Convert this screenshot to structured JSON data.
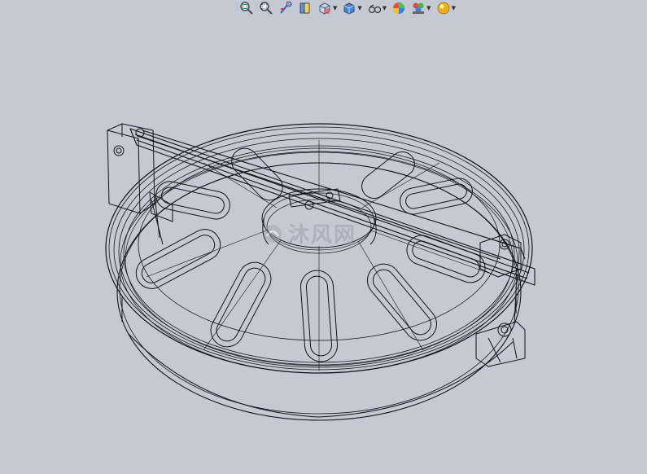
{
  "toolbar": {
    "items": [
      {
        "icon": "zoom-to-fit-icon",
        "has_menu": false
      },
      {
        "icon": "zoom-to-area-icon",
        "has_menu": false
      },
      {
        "icon": "previous-view-icon",
        "has_menu": false
      },
      {
        "icon": "section-view-icon",
        "has_menu": false
      },
      {
        "icon": "view-orientation-icon",
        "has_menu": true
      },
      {
        "icon": "display-style-icon",
        "has_menu": true
      },
      {
        "icon": "hide-show-items-icon",
        "has_menu": true
      },
      {
        "icon": "edit-appearance-icon",
        "has_menu": false
      },
      {
        "icon": "apply-scene-icon",
        "has_menu": true
      },
      {
        "icon": "view-settings-icon",
        "has_menu": true
      }
    ]
  },
  "viewport": {
    "background": "#c5c9d3",
    "display_mode": "wireframe"
  },
  "watermark": {
    "text": "沐风网"
  }
}
